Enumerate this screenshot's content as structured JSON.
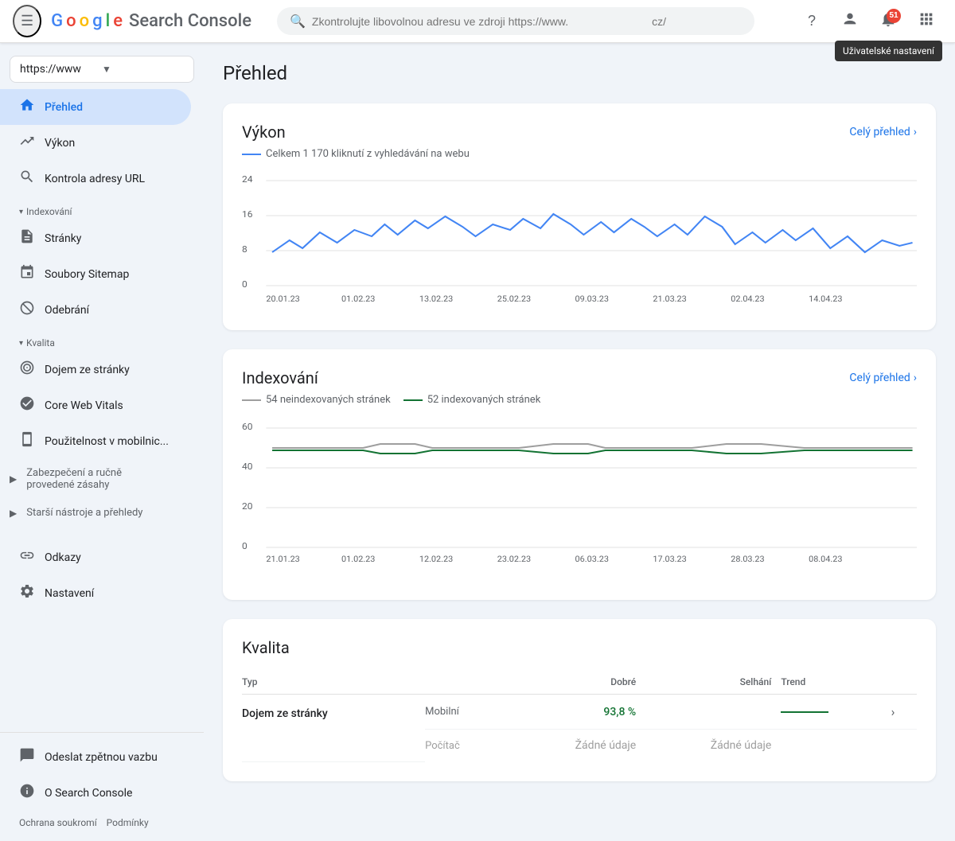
{
  "app": {
    "title": "Search Console",
    "logo_text": "Google",
    "logo_letters": [
      "G",
      "o",
      "o",
      "g",
      "l",
      "e"
    ]
  },
  "header": {
    "menu_icon": "☰",
    "search_placeholder": "Zkontrolujte libovolnou adresu ve zdroji https://www.",
    "search_suffix": "cz/",
    "help_icon": "?",
    "account_icon": "👤",
    "notifications_count": "51",
    "apps_icon": "⋮⋮⋮",
    "user_settings_tooltip": "Uživatelské nastavení"
  },
  "sidebar": {
    "property": "https://www",
    "dropdown_icon": "▼",
    "nav_items": [
      {
        "id": "prehled",
        "label": "Přehled",
        "icon": "🏠",
        "active": true
      },
      {
        "id": "vykon",
        "label": "Výkon",
        "icon": "↗"
      },
      {
        "id": "kontrola-url",
        "label": "Kontrola adresy URL",
        "icon": "🔍"
      }
    ],
    "indexovani_label": "Indexování",
    "indexovani_items": [
      {
        "id": "stranky",
        "label": "Stránky",
        "icon": "📄"
      },
      {
        "id": "sitemap",
        "label": "Soubory Sitemap",
        "icon": "🗂"
      },
      {
        "id": "odebrani",
        "label": "Odebrání",
        "icon": "🚫"
      }
    ],
    "kvalita_label": "Kvalita",
    "kvalita_items": [
      {
        "id": "dojem",
        "label": "Dojem ze stránky",
        "icon": "⭕"
      },
      {
        "id": "cwv",
        "label": "Core Web Vitals",
        "icon": "🔄"
      },
      {
        "id": "mobilni",
        "label": "Použitelnost v mobilnic...",
        "icon": "📱"
      }
    ],
    "bezpecnost_label": "Zabezpečení a ručně provedené zásahy",
    "starsi_label": "Starší nástroje a přehledy",
    "footer_items": [
      {
        "id": "odkazy",
        "label": "Odkazy",
        "icon": "🔗"
      },
      {
        "id": "nastaveni",
        "label": "Nastavení",
        "icon": "⚙"
      }
    ],
    "bottom_items": [
      {
        "id": "zpetna-vazba",
        "label": "Odeslat zpětnou vazbu",
        "icon": "💬"
      },
      {
        "id": "o-konzoli",
        "label": "O Search Console",
        "icon": "ℹ"
      }
    ],
    "footer_links": [
      "Ochrana soukromí",
      "Podmínky"
    ]
  },
  "main": {
    "page_title": "Přehled",
    "vykon_card": {
      "title": "Výkon",
      "link": "Celý přehled",
      "legend": "Celkem 1 170 kliknutí z vyhledávání na webu",
      "y_labels": [
        "24",
        "16",
        "8",
        "0"
      ],
      "x_labels": [
        "20.01.23",
        "01.02.23",
        "13.02.23",
        "25.02.23",
        "09.03.23",
        "21.03.23",
        "02.04.23",
        "14.04.23"
      ]
    },
    "indexovani_card": {
      "title": "Indexování",
      "link": "Celý přehled",
      "legend_gray": "54 neindexovaných stránek",
      "legend_green": "52 indexovaných stránek",
      "y_labels": [
        "60",
        "40",
        "20",
        "0"
      ],
      "x_labels": [
        "21.01.23",
        "01.02.23",
        "12.02.23",
        "23.02.23",
        "06.03.23",
        "17.03.23",
        "28.03.23",
        "08.04.23"
      ]
    },
    "kvalita_card": {
      "title": "Kvalita",
      "columns": {
        "typ": "Typ",
        "dobre": "Dobré",
        "selhani": "Selhání",
        "trend": "Trend"
      },
      "rows": [
        {
          "label": "Dojem ze stránky",
          "sub_rows": [
            {
              "label": "Mobilní",
              "dobre": "93,8 %",
              "selhani": "",
              "trend": "line"
            },
            {
              "label": "Počítač",
              "dobre": "Žádné údaje",
              "selhani": "Žádné údaje",
              "trend": ""
            }
          ]
        }
      ]
    }
  }
}
